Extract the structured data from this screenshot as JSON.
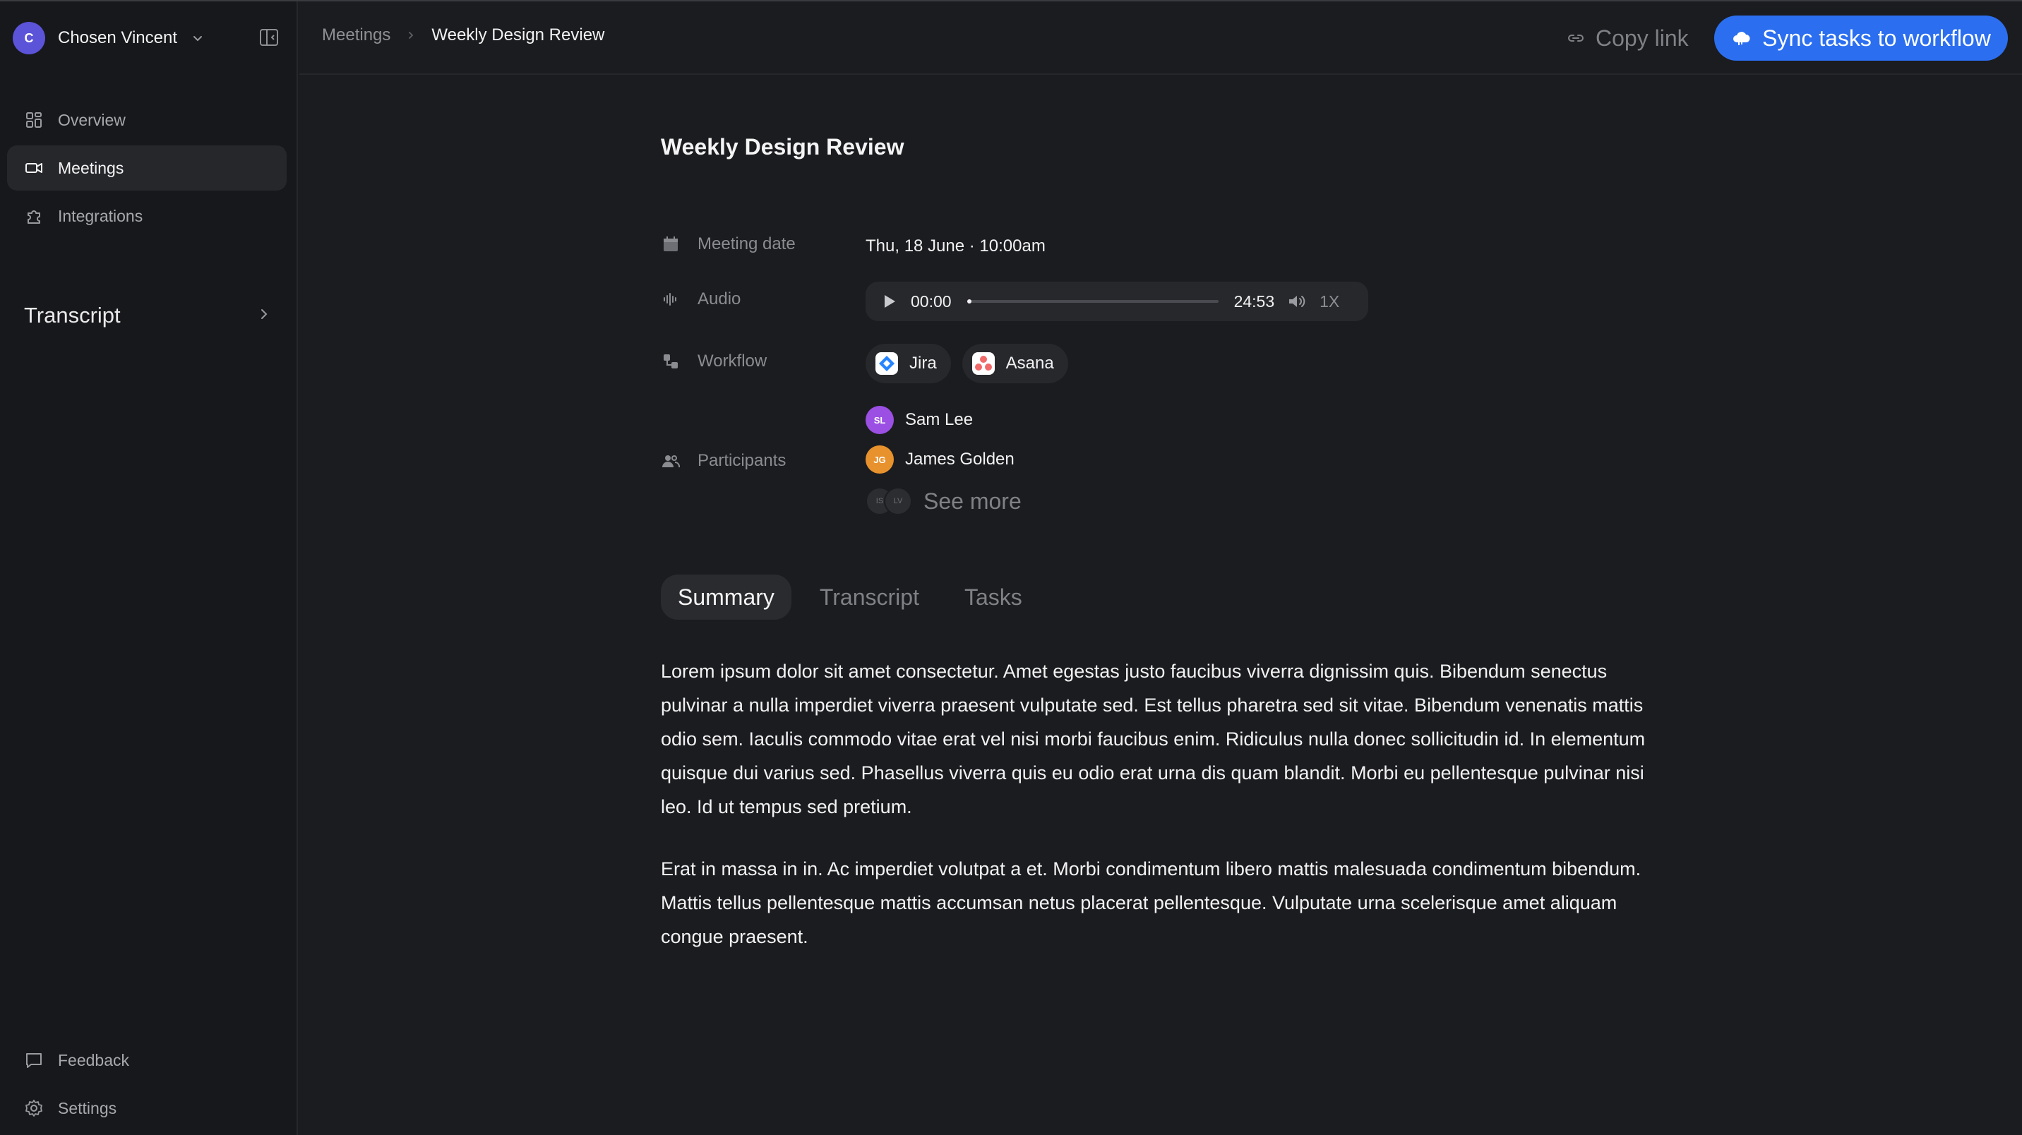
{
  "user": {
    "initial": "C",
    "name": "Chosen Vincent"
  },
  "sidebar": {
    "items": [
      {
        "label": "Overview",
        "icon": "grid-icon"
      },
      {
        "label": "Meetings",
        "icon": "video-icon"
      },
      {
        "label": "Integrations",
        "icon": "puzzle-icon"
      }
    ],
    "section_title": "Transcript",
    "bottom_items": [
      {
        "label": "Feedback",
        "icon": "chat-icon"
      },
      {
        "label": "Settings",
        "icon": "gear-icon"
      }
    ]
  },
  "breadcrumb": {
    "parent": "Meetings",
    "current": "Weekly Design Review"
  },
  "header": {
    "copy_link": "Copy link",
    "sync_button": "Sync tasks to workflow"
  },
  "meeting": {
    "title": "Weekly Design Review",
    "date_label": "Meeting date",
    "date_value": "Thu, 18 June · 10:00am",
    "audio_label": "Audio",
    "audio_current": "00:00",
    "audio_duration": "24:53",
    "audio_progress": 0.01,
    "audio_speed": "1X",
    "workflow_label": "Workflow",
    "workflows": [
      {
        "name": "Jira",
        "icon": "jira-logo"
      },
      {
        "name": "Asana",
        "icon": "asana-logo"
      }
    ],
    "participants_label": "Participants",
    "participants": [
      {
        "initials": "SL",
        "name": "Sam Lee",
        "color": "#9b4fe3"
      },
      {
        "initials": "JG",
        "name": "James Golden",
        "color": "#e8922e"
      }
    ],
    "more_initials": [
      "IS",
      "LV"
    ],
    "see_more": "See more"
  },
  "tabs": [
    "Summary",
    "Transcript",
    "Tasks"
  ],
  "summary": {
    "paragraphs": [
      "Lorem ipsum dolor sit amet consectetur. Amet egestas justo faucibus viverra dignissim quis. Bibendum senectus pulvinar a nulla imperdiet viverra praesent vulputate sed. Est tellus pharetra sed sit vitae. Bibendum venenatis mattis odio sem. Iaculis commodo vitae erat vel nisi morbi faucibus enim. Ridiculus nulla donec sollicitudin id. In elementum quisque dui varius sed. Phasellus viverra quis eu odio erat urna dis quam blandit. Morbi eu pellentesque pulvinar nisi leo. Id ut tempus sed pretium.",
      "Erat in massa in in. Ac imperdiet volutpat a et. Morbi condimentum libero mattis malesuada condimentum bibendum. Mattis tellus pellentesque mattis accumsan netus placerat pellentesque. Vulputate urna scelerisque amet aliquam congue praesent."
    ]
  },
  "colors": {
    "accent": "#2b6ff0",
    "background": "#1b1c1f",
    "sidebar": "#17181b"
  }
}
